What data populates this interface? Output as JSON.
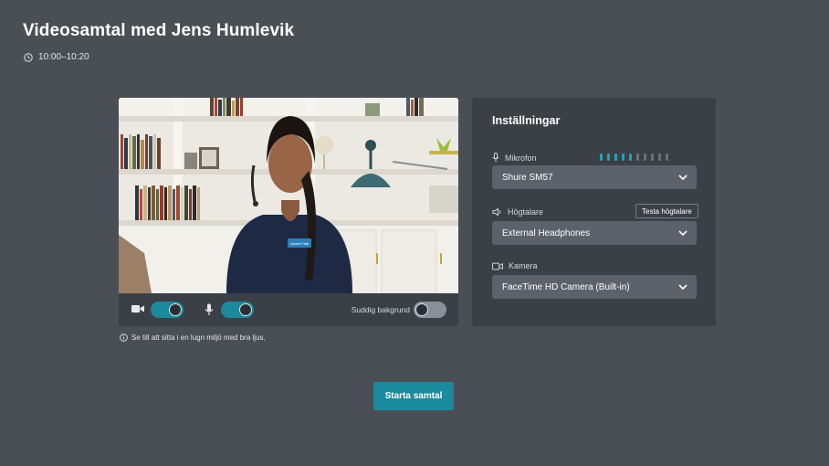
{
  "header": {
    "title": "Videosamtal med Jens Humlevik",
    "time": "10:00–10:20"
  },
  "video": {
    "badge_text": "Ayesha Patel",
    "blur_label": "Suddig bakgrund",
    "camera_on": true,
    "mic_on": true,
    "blur_on": false
  },
  "hint": "Se till att sitta i en lugn miljö med bra ljus.",
  "settings": {
    "title": "Inställningar",
    "microphone": {
      "label": "Mikrofon",
      "value": "Shure SM57",
      "level_bars_lit": 5,
      "level_bars_total": 10
    },
    "speaker": {
      "label": "Högtalare",
      "value": "External Headphones",
      "test_label": "Testa högtalare"
    },
    "camera": {
      "label": "Kamera",
      "value": "FaceTime HD Camera (Built-in)"
    }
  },
  "start_button": "Starta samtal",
  "colors": {
    "background": "#4a4e55",
    "card": "#3b3f46",
    "accent": "#1b8a9c",
    "select": "#5d626a"
  }
}
